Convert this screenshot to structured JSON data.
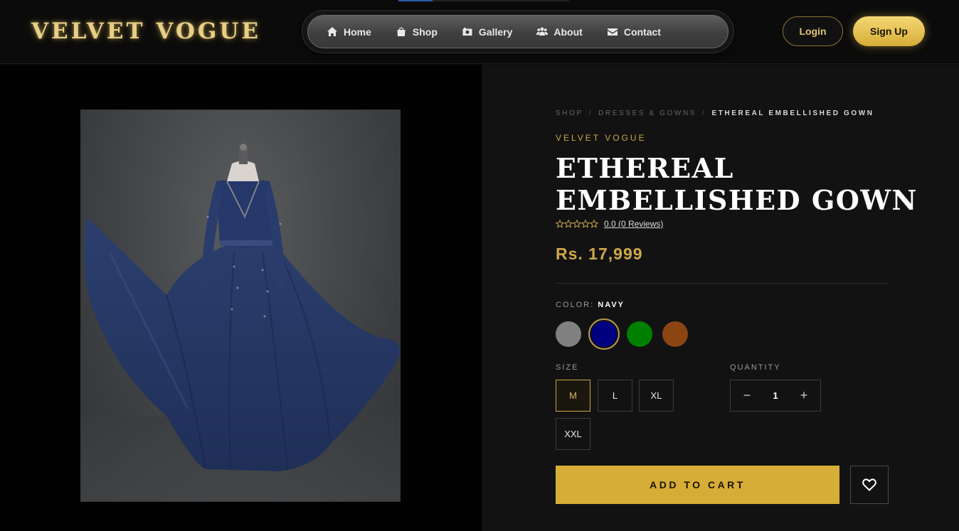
{
  "brand_logo": "VELVET VOGUE",
  "nav": {
    "items": [
      {
        "label": "Home",
        "icon": "home-icon"
      },
      {
        "label": "Shop",
        "icon": "shopping-bag-icon"
      },
      {
        "label": "Gallery",
        "icon": "camera-icon"
      },
      {
        "label": "About",
        "icon": "users-icon"
      },
      {
        "label": "Contact",
        "icon": "envelope-icon"
      }
    ]
  },
  "auth": {
    "login_label": "Login",
    "signup_label": "Sign Up"
  },
  "breadcrumb": [
    "SHOP",
    "DRESSES & GOWNS",
    "ETHEREAL EMBELLISHED GOWN"
  ],
  "breadcrumb_separator": "/",
  "product": {
    "brand": "VELVET VOGUE",
    "title": "ETHEREAL EMBELLISHED GOWN",
    "rating_text": "0.0 (0 Reviews)",
    "rating_value": 0,
    "price": "Rs. 17,999",
    "image_icon": "navy-gown-photo"
  },
  "color": {
    "label": "COLOR:",
    "selected_name": "NAVY",
    "swatches": [
      {
        "name": "gray",
        "hex": "#808080"
      },
      {
        "name": "navy",
        "hex": "#000080",
        "selected": true
      },
      {
        "name": "green",
        "hex": "#008000"
      },
      {
        "name": "brown",
        "hex": "#8b4513"
      }
    ]
  },
  "size": {
    "label": "SIZE",
    "options": [
      "M",
      "L",
      "XL",
      "XXL"
    ],
    "selected": "M"
  },
  "quantity": {
    "label": "QUANTITY",
    "value": "1",
    "minus": "−",
    "plus": "+"
  },
  "add_to_cart_label": "ADD TO CART",
  "colors": {
    "accent_gold": "#d6ad37",
    "background": "#121212"
  }
}
